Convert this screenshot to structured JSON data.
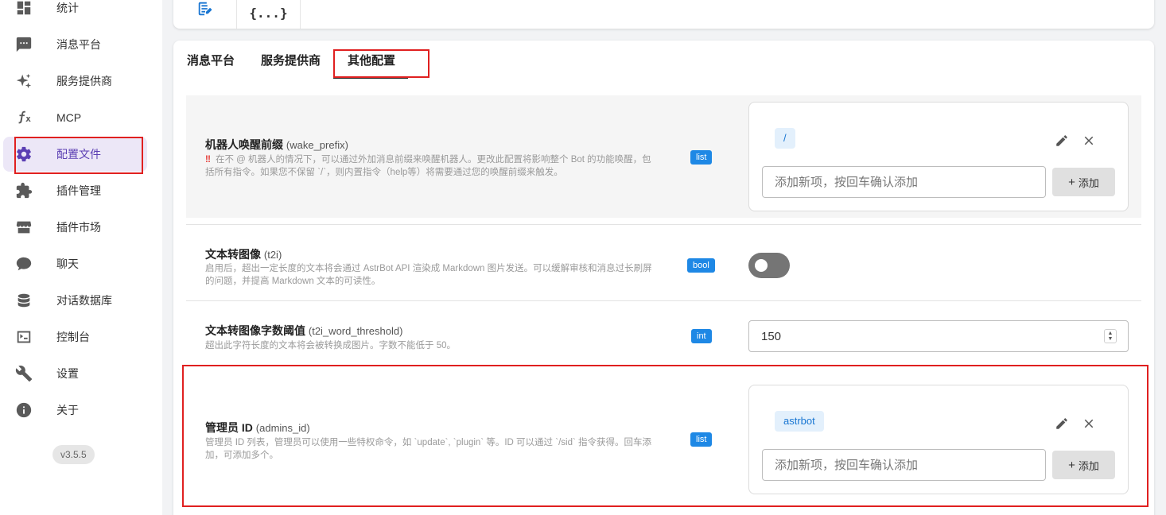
{
  "sidebar": {
    "items": [
      {
        "label": "统计",
        "icon": "dashboard-icon"
      },
      {
        "label": "消息平台",
        "icon": "message-icon"
      },
      {
        "label": "服务提供商",
        "icon": "sparkle-icon"
      },
      {
        "label": "MCP",
        "icon": "function-icon"
      },
      {
        "label": "配置文件",
        "icon": "gear-icon",
        "active": true
      },
      {
        "label": "插件管理",
        "icon": "puzzle-icon"
      },
      {
        "label": "插件市场",
        "icon": "store-icon"
      },
      {
        "label": "聊天",
        "icon": "chat-bubble-icon"
      },
      {
        "label": "对话数据库",
        "icon": "database-icon"
      },
      {
        "label": "控制台",
        "icon": "console-icon"
      },
      {
        "label": "设置",
        "icon": "wrench-icon"
      },
      {
        "label": "关于",
        "icon": "info-icon"
      }
    ],
    "version": "v3.5.5"
  },
  "top_tabs": [
    {
      "name": "visual-editor",
      "icon": "form-edit-icon"
    },
    {
      "name": "code-editor",
      "label": "{...}"
    }
  ],
  "tabs": [
    "消息平台",
    "服务提供商",
    "其他配置"
  ],
  "active_tab": "其他配置",
  "settings": {
    "wake_prefix": {
      "title": "机器人唤醒前缀",
      "key": "(wake_prefix)",
      "warn": "‼",
      "desc": "在不 @ 机器人的情况下，可以通过外加消息前缀来唤醒机器人。更改此配置将影响整个 Bot 的功能唤醒，包括所有指令。如果您不保留 `/`，则内置指令（help等）将需要通过您的唤醒前缀来触发。",
      "type": "list",
      "items": [
        "/"
      ],
      "placeholder": "添加新项，按回车确认添加",
      "add_label": "添加"
    },
    "t2i": {
      "title": "文本转图像",
      "key": "(t2i)",
      "desc": "启用后，超出一定长度的文本将会通过 AstrBot API 渲染成 Markdown 图片发送。可以缓解审核和消息过长刷屏的问题，并提高 Markdown 文本的可读性。",
      "type": "bool",
      "value": false
    },
    "t2i_word_threshold": {
      "title": "文本转图像字数阈值",
      "key": "(t2i_word_threshold)",
      "desc": "超出此字符长度的文本将会被转换成图片。字数不能低于 50。",
      "type": "int",
      "value": "150"
    },
    "admins_id": {
      "title": "管理员 ID",
      "key": "(admins_id)",
      "desc": "管理员 ID 列表，管理员可以使用一些特权命令，如 `update`, `plugin` 等。ID 可以通过 `/sid` 指令获得。回车添加，可添加多个。",
      "type": "list",
      "items": [
        "astrbot"
      ],
      "placeholder": "添加新项，按回车确认添加",
      "add_label": "添加"
    }
  },
  "colors": {
    "accent": "#5b3fb3",
    "badge": "#1e88e5",
    "highlight": "#e02020",
    "chip_bg": "#e3f0fc"
  }
}
